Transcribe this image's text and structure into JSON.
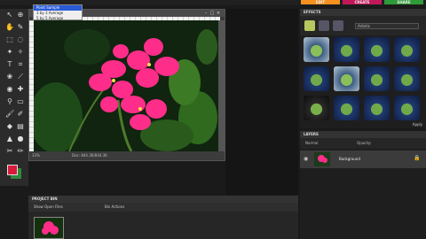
{
  "mode_tabs": {
    "edit": "EDIT",
    "create": "CREATE",
    "share": "SHARE"
  },
  "sample_menu": {
    "items": [
      "Point Sample",
      "3 by 3 Average",
      "5 by 5 Average"
    ],
    "selected_index": 0
  },
  "document": {
    "status_left": "33%",
    "status_doc": "Doc: 844.3K/844.3K"
  },
  "effects": {
    "title": "EFFECTS",
    "dropdown": "Artistic",
    "apply_label": "Apply"
  },
  "layers": {
    "title": "LAYERS",
    "blend_mode": "Normal",
    "opacity_label": "Opacity:",
    "layer_name": "Background"
  },
  "project_bin": {
    "title": "PROJECT BIN",
    "show_label": "Show Open Files",
    "actions_label": "Bin Actions"
  },
  "colors": {
    "edit_tab": "#f7921e",
    "create_tab": "#c2185b",
    "share_tab": "#2e9a38",
    "menu_highlight": "#2a5bd7",
    "foreground_swatch": "#d81b3c",
    "background_swatch": "#2e8b3a"
  }
}
